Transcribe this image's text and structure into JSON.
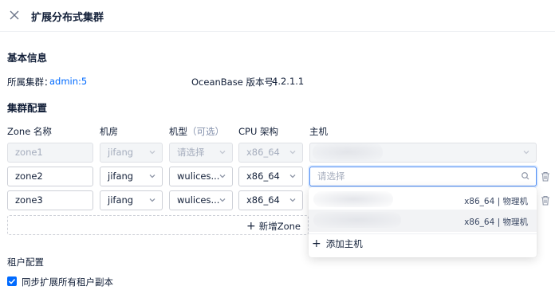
{
  "header": {
    "title": "扩展分布式集群",
    "close_icon": "close-icon"
  },
  "basic_info": {
    "section_title": "基本信息",
    "cluster_label": "所属集群：",
    "cluster_value": "admin:5",
    "version_label": "OceanBase 版本号：",
    "version_value": "4.2.1.1"
  },
  "cluster_config": {
    "section_title": "集群配置",
    "columns": {
      "zone": "Zone 名称",
      "idc": "机房",
      "type": "机型",
      "type_hint": "（可选）",
      "cpu": "CPU 架构",
      "host": "主机"
    },
    "rows": [
      {
        "zone": "zone1",
        "idc": "jifang",
        "type": "请选择",
        "cpu": "x86_64",
        "host": "",
        "disabled": true
      },
      {
        "zone": "zone2",
        "idc": "jifang",
        "type": "wulices...",
        "cpu": "x86_64",
        "host_placeholder": "请选择"
      },
      {
        "zone": "zone3",
        "idc": "jifang",
        "type": "wulices...",
        "cpu": "x86_64",
        "host": ""
      }
    ],
    "add_zone_label": "新增Zone"
  },
  "host_dropdown": {
    "options": [
      {
        "meta": "x86_64 | 物理机"
      },
      {
        "meta": "x86_64 | 物理机"
      }
    ],
    "add_host_label": "添加主机"
  },
  "tenant_config": {
    "section_title": "租户配置",
    "sync_label": "同步扩展所有租户副本",
    "sync_checked": true
  },
  "colors": {
    "accent": "#006aff",
    "text": "#132039",
    "muted": "#8592ad",
    "border": "#cdd0d7"
  }
}
